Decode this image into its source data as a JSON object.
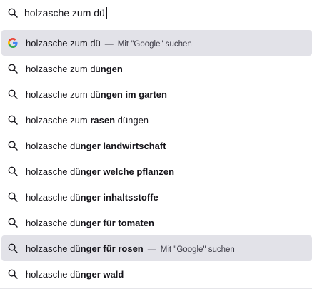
{
  "search": {
    "icon": "search-icon",
    "query": "holzasche zum dü"
  },
  "suggestions": [
    {
      "icon": "google-icon",
      "prefix": "holzasche zum dü",
      "bold": "",
      "after": "",
      "action": "Mit \"Google\" suchen",
      "highlighted": true
    },
    {
      "icon": "search-icon",
      "prefix": "holzasche zum dü",
      "bold": "ngen",
      "after": "",
      "action": "",
      "highlighted": false
    },
    {
      "icon": "search-icon",
      "prefix": "holzasche zum dü",
      "bold": "ngen im garten",
      "after": "",
      "action": "",
      "highlighted": false
    },
    {
      "icon": "search-icon",
      "prefix": "holzasche zum ",
      "bold": "rasen",
      "after": " düngen",
      "action": "",
      "highlighted": false
    },
    {
      "icon": "search-icon",
      "prefix": "holzasche dü",
      "bold": "nger landwirtschaft",
      "after": "",
      "action": "",
      "highlighted": false
    },
    {
      "icon": "search-icon",
      "prefix": "holzasche dü",
      "bold": "nger welche pflanzen",
      "after": "",
      "action": "",
      "highlighted": false
    },
    {
      "icon": "search-icon",
      "prefix": "holzasche dü",
      "bold": "nger inhaltsstoffe",
      "after": "",
      "action": "",
      "highlighted": false
    },
    {
      "icon": "search-icon",
      "prefix": "holzasche dü",
      "bold": "nger für tomaten",
      "after": "",
      "action": "",
      "highlighted": false
    },
    {
      "icon": "search-icon",
      "prefix": "holzasche dü",
      "bold": "nger für rosen",
      "after": "",
      "action": "Mit \"Google\" suchen",
      "highlighted": true
    },
    {
      "icon": "search-icon",
      "prefix": "holzasche dü",
      "bold": "nger wald",
      "after": "",
      "action": "",
      "highlighted": false
    }
  ],
  "separator": "—"
}
